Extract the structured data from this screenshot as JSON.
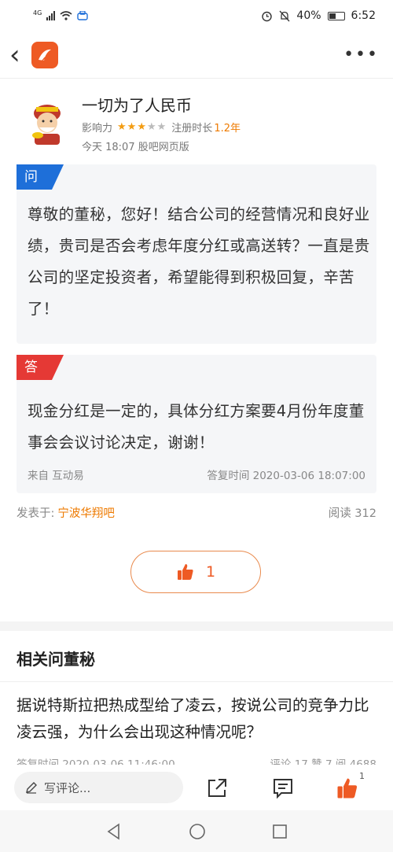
{
  "status_bar": {
    "network": "4G",
    "battery_percent": "40%",
    "time": "6:52"
  },
  "header": {
    "back_icon": "chevron-left-icon",
    "more_icon": "more-dots-icon"
  },
  "user": {
    "name": "一切为了人民币",
    "influence_label": "影响力",
    "rating_stars": 3,
    "rating_max": 5,
    "reg_label": "注册时长",
    "reg_value": "1.2年",
    "posted_info": "今天 18:07 股吧网页版"
  },
  "question": {
    "tag": "问",
    "text": "尊敬的董秘，您好！结合公司的经营情况和良好业绩，贵司是否会考虑年度分红或高送转？一直是贵公司的坚定投资者，希望能得到积极回复，辛苦了！"
  },
  "answer": {
    "tag": "答",
    "text": "现金分红是一定的，具体分红方案要4月份年度董事会会议讨论决定，谢谢！",
    "source": "来自 互动易",
    "reply_time": "答复时间 2020-03-06 18:07:00"
  },
  "post": {
    "published_label": "发表于:",
    "forum": "宁波华翔吧",
    "reads": "阅读 312"
  },
  "like": {
    "count": "1"
  },
  "related": {
    "title": "相关问董秘",
    "item": {
      "question": "据说特斯拉把热成型给了凌云，按说公司的竞争力比凌云强，为什么会出现这种情况呢？",
      "time": "答复时间 2020-03-06 11:46:00",
      "stats": "评论 17 赞 7 阅 4688"
    }
  },
  "bottom_bar": {
    "comment_placeholder": "写评论...",
    "like_badge": "1"
  },
  "colors": {
    "accent": "#ee5a24",
    "question_tag": "#1e6fd9",
    "answer_tag": "#e53935",
    "star": "#f39c12"
  }
}
